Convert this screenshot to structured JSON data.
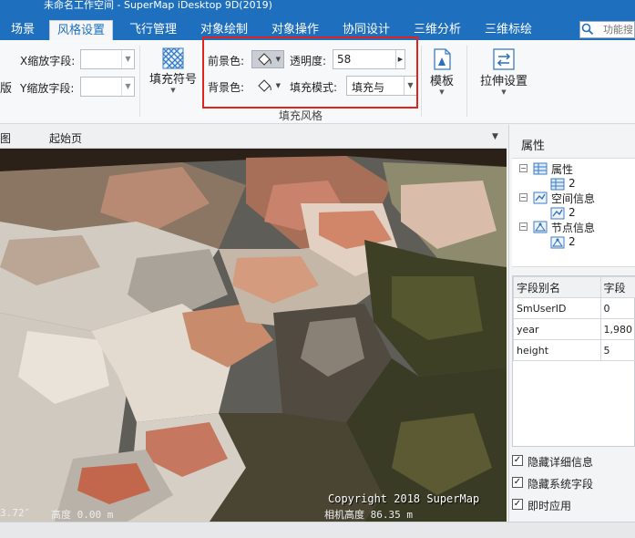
{
  "app_title": "未命名工作空间 - SuperMap iDesktop 9D(2019)",
  "tabs": [
    {
      "label": "场景"
    },
    {
      "label": "风格设置"
    },
    {
      "label": "飞行管理"
    },
    {
      "label": "对象绘制"
    },
    {
      "label": "对象操作"
    },
    {
      "label": "协同设计"
    },
    {
      "label": "三维分析"
    },
    {
      "label": "三维标绘"
    }
  ],
  "search": {
    "placeholder": "功能搜"
  },
  "ribbon": {
    "x_scale_label": "X缩放字段:",
    "y_scale_label": "Y缩放字段:",
    "cut_left_label": "版",
    "fill_symbol_label": "填充符号",
    "foreground_label": "前景色:",
    "background_label": "背景色:",
    "opacity_label": "透明度:",
    "opacity_value": "58",
    "fill_mode_label": "填充模式:",
    "fill_mode_value": "填充与",
    "group_caption": "填充风格",
    "template_label": "模板",
    "stretch_label": "拉伸设置"
  },
  "doc_tabs": [
    {
      "label": "图"
    },
    {
      "label": "起始页"
    }
  ],
  "scene": {
    "copyright": "Copyright 2018 SuperMap",
    "left_value": "3.72″",
    "altitude": "高度 0.00 m",
    "camera_height": "相机高度 86.35 m"
  },
  "properties": {
    "title": "属性",
    "tree": [
      {
        "label": "属性",
        "child": "2"
      },
      {
        "label": "空间信息",
        "child": "2"
      },
      {
        "label": "节点信息",
        "child": "2"
      }
    ],
    "table": {
      "headers": [
        "字段别名",
        "字段"
      ],
      "rows": [
        [
          "SmUserID",
          "0"
        ],
        [
          "year",
          "1,980"
        ],
        [
          "height",
          "5"
        ]
      ]
    },
    "checkboxes": [
      {
        "label": "隐藏详细信息",
        "checked": true
      },
      {
        "label": "隐藏系统字段",
        "checked": true
      },
      {
        "label": "即时应用",
        "checked": true
      }
    ]
  },
  "colors": {
    "accent": "#1f6fbf",
    "highlight": "#e0231c"
  }
}
